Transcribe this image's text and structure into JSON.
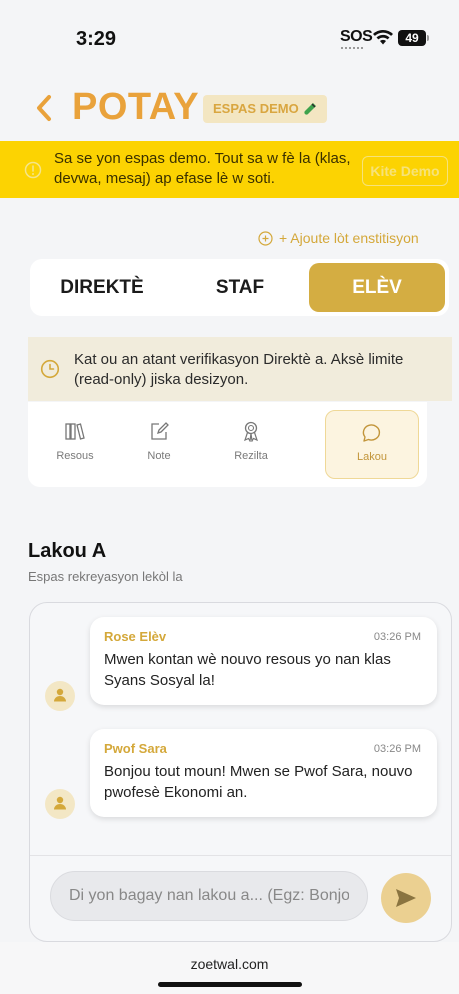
{
  "status_bar": {
    "time": "3:29",
    "signal": "SOS",
    "battery": "49"
  },
  "header": {
    "title": "POTAY",
    "badge": "ESPAS DEMO"
  },
  "demo_banner": {
    "text": "Sa se yon espas demo. Tout sa w fè la (klas, devwa, mesaj) ap efase lè w soti.",
    "exit_label": "Kite Demo"
  },
  "add_institution": "+ Ajoute lòt enstitisyon",
  "role_tabs": [
    {
      "label": "DIREKTÈ",
      "active": false
    },
    {
      "label": "STAF",
      "active": false
    },
    {
      "label": "ELÈV",
      "active": true
    }
  ],
  "pending_notice": "Kat ou an atant verifikasyon Direktè a. Aksè limite (read-only) jiska desizyon.",
  "section_tabs": [
    {
      "label": "Resous",
      "icon": "library-icon",
      "active": false
    },
    {
      "label": "Note",
      "icon": "edit-note-icon",
      "active": false
    },
    {
      "label": "Rezilta",
      "icon": "award-icon",
      "active": false
    },
    {
      "label": "Lakou",
      "icon": "chat-bubble-icon",
      "active": true
    }
  ],
  "group": {
    "title": "Lakou A",
    "subtitle": "Espas rekreyasyon lekòl la"
  },
  "messages": [
    {
      "sender": "Rose Elèv",
      "time": "03:26 PM",
      "text": "Mwen kontan wè nouvo resous yo nan klas Syans Sosyal la!"
    },
    {
      "sender": "Pwof Sara",
      "time": "03:26 PM",
      "text": "Bonjou tout moun! Mwen se Pwof Sara, nouvo pwofesè Ekonomi an."
    }
  ],
  "composer": {
    "placeholder": "Di yon bagay nan lakou a... (Egz: Bonjou tout moun)"
  },
  "browser": {
    "url": "zoetwal.com"
  },
  "colors": {
    "accent": "#d4ad42",
    "brand_orange": "#e9a23b",
    "banner": "#fcd302"
  }
}
